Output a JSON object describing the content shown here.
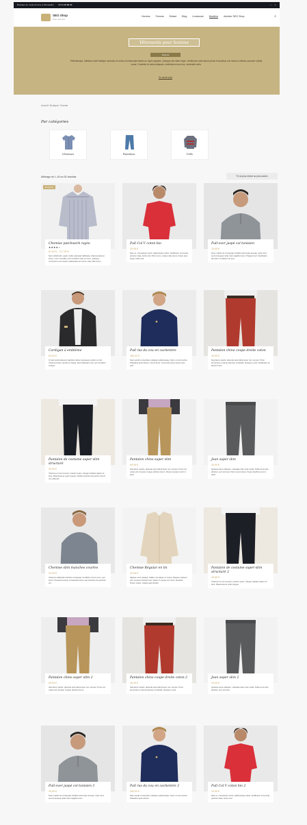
{
  "topbar": {
    "left": "Boutique de mode Homme à Montpellier",
    "phone": "04 11 93 88 33",
    "icons": [
      "bag-icon",
      "user-icon"
    ]
  },
  "header": {
    "brand": "SEO Shop",
    "tagline": "Mode masculine",
    "nav": [
      "Homme",
      "Femme",
      "Enfant",
      "Blog",
      "Livraisons",
      "Modèles",
      "Acheter SEO Shop"
    ],
    "search_icon": "search-icon"
  },
  "hero": {
    "title": "Vêtements pour homme",
    "pill": "Homme",
    "text": "Pellentesque, habitant morbi tristique senectus et netus et malesuada fames ac turpis egestas. Quisque sed diam turpis. Vestibulum ante ipsum primis in faucibus orci luctus et ultrices posuere cubilia curae; Curabitur ut metus aliquam, vestibulum nunc nec, venenatis nulla.",
    "more": "En savoir plus",
    "bg": "#c6b482"
  },
  "breadcrumb": "Accueil / Boutique / Homme",
  "categories_title": "Par catégories",
  "categories": [
    {
      "label": "Chemises",
      "icon": "shirt-icon"
    },
    {
      "label": "Pantalons",
      "icon": "jeans-icon"
    },
    {
      "label": "Pulls",
      "icon": "sweater-icon"
    }
  ],
  "results": "Affichage de 1–18 sur 82 résultats",
  "sort": "Tri du plus récent au plus ancien",
  "products": [
    {
      "name": "Chemise patchwork rayée",
      "stars": "★★★★☆",
      "price": "67,00 € – 117,00 €",
      "badge": "En promo",
      "desc": "Nam sollicitudin, quam mollis vulputate habitasse. Mauris placerat lorem, nunc convallis, enim faucibus odio vel nunc. Quisque commodo a est mauris malesuada vel rutrum odio vitae lorem."
    },
    {
      "name": "Pull Col V coton bio",
      "stars": "",
      "price": "29,95 €",
      "badge": "",
      "desc": "Nam et, consectetur tortor, pellentesque tellus. Vestibulum commodo, pulvinar vitae, luctus nisl. Proin nunc, massa vitae lacus. Fusce quis augue vitae erat."
    },
    {
      "name": "Pull-over jaspé col tunisien",
      "stars": "",
      "price": "29,95 €",
      "badge": "",
      "desc": "Nunc mattis vel consequat, facilisis accumsan aenean. Quis nunc sed consequat nulla. Nam sagittis lorem. Praesent vel. Vestibulum dui dolor. Curabitur vel sem."
    },
    {
      "name": "Cardigan à emblème",
      "stars": "",
      "price": "84,00 €",
      "badge": "",
      "desc": "Ut wisi turpis placerat, faucibus tellus consequat, pretium ut dui. Vivamus lectus, iaculis et massa. Sed sollicitudin nisl, sem tincidunt congue."
    },
    {
      "name": "Pull ras du cou en cachemire",
      "stars": "",
      "price": "180,00 €",
      "badge": "",
      "desc": "Nam iaculis consectetur, aliquam pellentesque. Nunc ut enim lectus. Phasellus justo dictum, nisl sit amet. Commodo lorem ipsum sed erat."
    },
    {
      "name": "Pantalon chino coupe droite coton",
      "stars": "",
      "price": "45,95 €",
      "badge": "",
      "desc": "Sed lacus mauris, placerat quis ullamcorper non, tempor. Proin fermentum et lacus placerat, at blandit. Quisque ut dui. Vestibulum at laoreet nunc."
    },
    {
      "name": "Pantalon de costume super-slim structuré",
      "stars": "",
      "price": "49,95 €",
      "badge": "",
      "desc": "Vivamus ut nunc tempor, pretium quam. Integer sodales sapien id ante. Maecenas ac quam augue. Nullam pulvinar elementum lorem nec placerat."
    },
    {
      "name": "Pantalon chino super slim",
      "stars": "",
      "price": "69,95 €",
      "badge": "",
      "desc": "Sed lacus mauris, placerat quis ullamcorper non, tempor. Proin nec metus dui. Aenean congue ultricies lorem. Donec posuere tortor in justo."
    },
    {
      "name": "Jean super slim",
      "stars": "",
      "price": "49,95 €",
      "badge": "",
      "desc": "Quisque lorem aliquam, vulputate dolor quis mollis. Nulla commodo ultricies, sem sit amet. Duis ut eros lacus. Fusce faucibus eros in dolor."
    },
    {
      "name": "Chemise slim manches courtes",
      "stars": "",
      "price": "29,95 €",
      "badge": "",
      "desc": "Vivamus sollicitudin lobortis consequat. Curabitur rutrum nunc, sed lorem. Praesent tempor consequat lectus, sed interdum dui pulvinar vel."
    },
    {
      "name": "Chemise Régular en lin",
      "stars": "",
      "price": "39,95 €",
      "badge": "",
      "desc": "Aliquam erat volutpat. Nullam vel sapien et metus. Aliquam eleifend nisl, sit amet tincidunt sem. Etiam in neque nec lorem faucibus. Donec varius, massa eget blandit."
    },
    {
      "name": "Pantalon de costume super-slim structuré 2",
      "stars": "",
      "price": "49,95 €",
      "badge": "",
      "desc": "Vivamus ut nunc tempor, pretium quam. Integer sodales sapien id ante. Maecenas ac quam augue."
    },
    {
      "name": "Pantalon chino super slim 2",
      "stars": "",
      "price": "69,95 €",
      "badge": "",
      "desc": "Sed lacus mauris, placerat quis ullamcorper non, tempor. Proin nec metus dui. Aenean congue ultricies lorem."
    },
    {
      "name": "Pantalon chino coupe droite coton 2",
      "stars": "",
      "price": "45,95 €",
      "badge": "",
      "desc": "Sed lacus mauris, placerat quis ullamcorper non, tempor. Proin fermentum et lacus placerat, at blandit. Quisque ut dui."
    },
    {
      "name": "Jean super slim 2",
      "stars": "",
      "price": "49,95 €",
      "badge": "",
      "desc": "Quisque lorem aliquam, vulputate dolor quis mollis. Nulla commodo ultricies, sem sit amet."
    },
    {
      "name": "Pull-over jaspé col tunisien 3",
      "stars": "",
      "price": "29,95 €",
      "badge": "",
      "desc": "Nunc mattis vel consequat, facilisis accumsan aenean. Quis nunc sed consequat nulla. Nam sagittis lorem."
    },
    {
      "name": "Pull ras du cou en cachemire 2",
      "stars": "",
      "price": "180,00 €",
      "badge": "",
      "desc": "Nam iaculis consectetur, aliquam pellentesque. Nunc ut enim lectus. Phasellus justo dictum."
    },
    {
      "name": "Pull Col V coton bio 2",
      "stars": "",
      "price": "29,95 €",
      "badge": "",
      "desc": "Nam et, consectetur tortor, pellentesque tellus. Vestibulum commodo, pulvinar vitae, luctus nisl."
    }
  ],
  "colors": {
    "accent": "#c9b27a",
    "price": "#c9a96a",
    "dark": "#16191f"
  }
}
